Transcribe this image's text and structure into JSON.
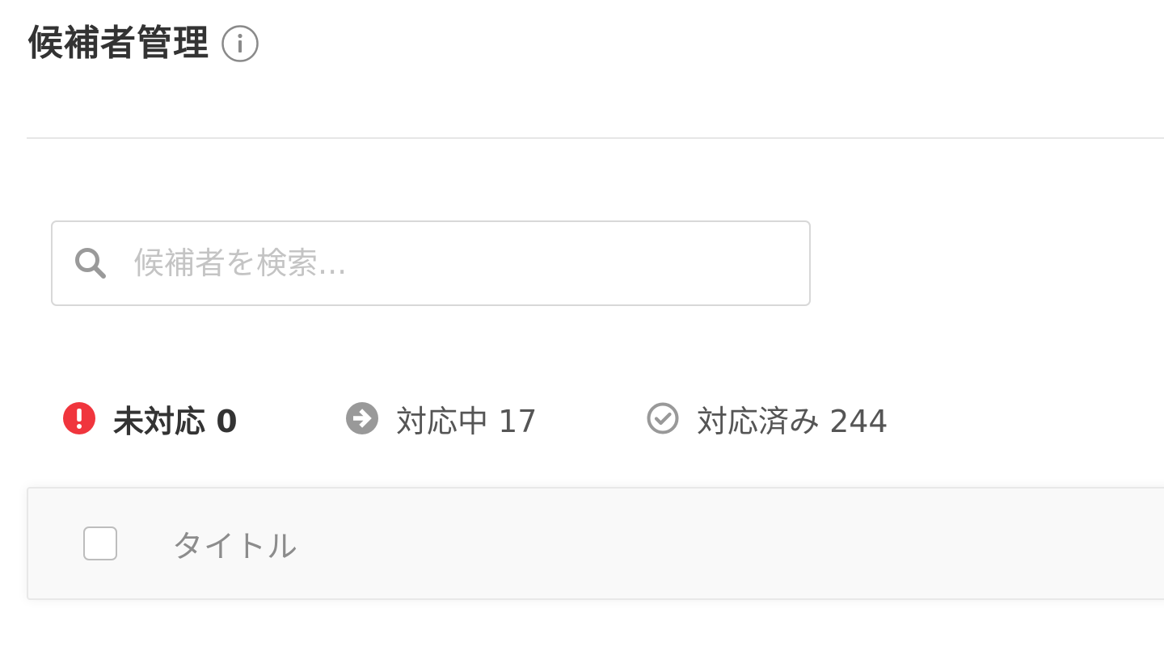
{
  "header": {
    "title": "候補者管理",
    "info_icon": "info-icon"
  },
  "search": {
    "icon": "search-icon",
    "value": "",
    "placeholder": "候補者を検索..."
  },
  "status_tabs": [
    {
      "label": "未対応 0",
      "icon": "exclamation-circle-icon",
      "icon_color": "#f0353d",
      "active": true
    },
    {
      "label": "対応中 17",
      "icon": "arrow-right-circle-icon",
      "icon_color": "#999999",
      "active": false
    },
    {
      "label": "対応済み 244",
      "icon": "check-circle-icon",
      "icon_color": "#999999",
      "active": false
    }
  ],
  "table": {
    "columns": [
      {
        "label": "タイトル"
      }
    ]
  },
  "colors": {
    "text": "#333333",
    "muted": "#8c8c8c",
    "alert": "#f0353d",
    "border": "#d8d8d8"
  }
}
